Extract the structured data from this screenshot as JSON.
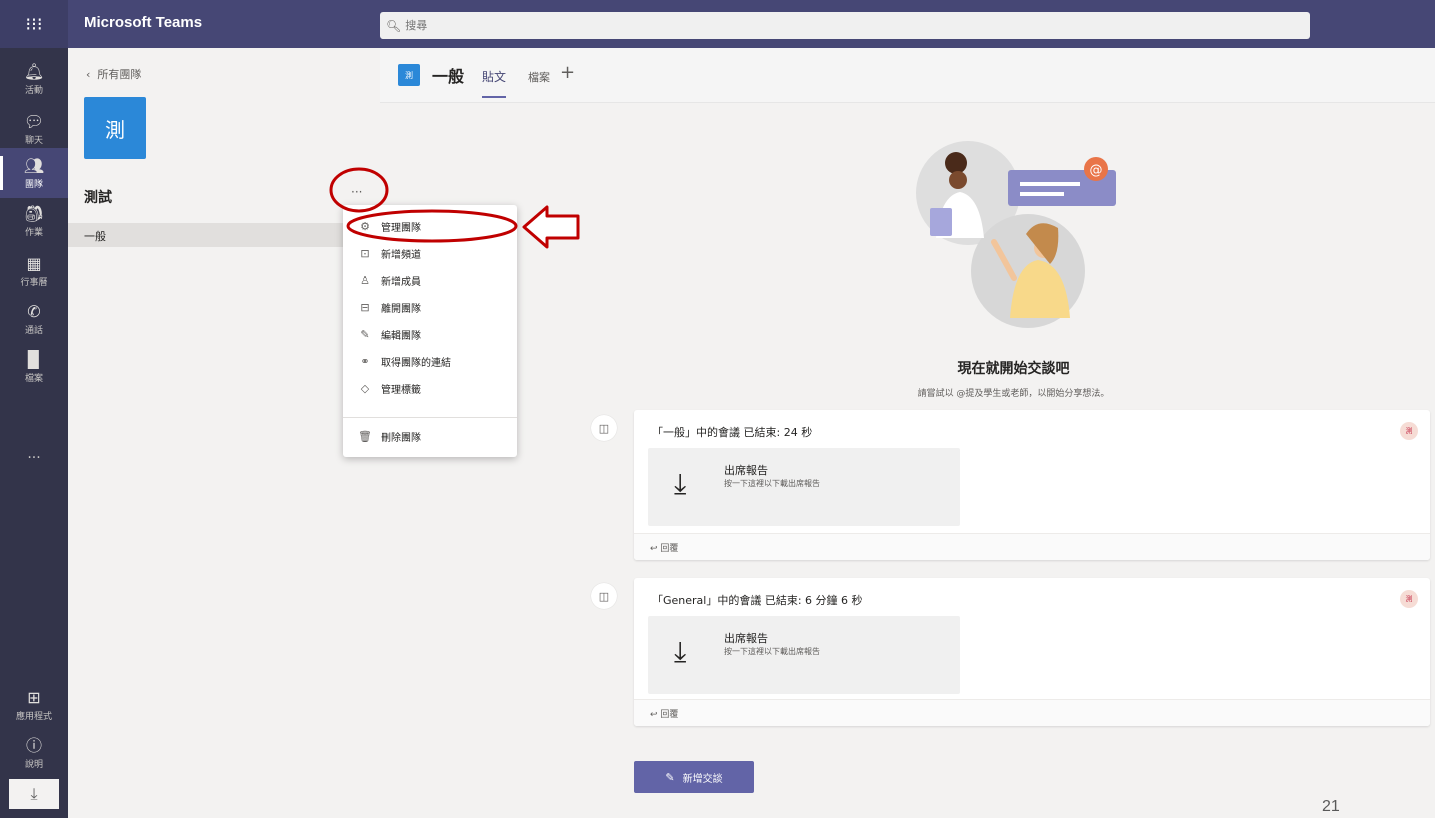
{
  "topbar": {
    "app_title": "Microsoft Teams",
    "search_icon": "search-icon",
    "search_placeholder": "搜尋"
  },
  "rail": {
    "items": [
      {
        "label": "活動",
        "icon": "bell-icon"
      },
      {
        "label": "聊天",
        "icon": "chat-icon"
      },
      {
        "label": "團隊",
        "icon": "teams-icon"
      },
      {
        "label": "作業",
        "icon": "assignments-icon"
      },
      {
        "label": "行事曆",
        "icon": "calendar-icon"
      },
      {
        "label": "通話",
        "icon": "phone-icon"
      },
      {
        "label": "檔案",
        "icon": "file-icon"
      }
    ],
    "more": "···",
    "apps_label": "應用程式",
    "help_label": "說明"
  },
  "team_panel": {
    "back_label": "所有團隊",
    "team_avatar_text": "測",
    "team_name": "測試",
    "more_label": "···",
    "channels": [
      {
        "label": "一般"
      }
    ]
  },
  "context_menu": {
    "items": [
      {
        "label": "管理團隊",
        "icon": "gear-icon"
      },
      {
        "label": "新增頻道",
        "icon": "add-channel-icon"
      },
      {
        "label": "新增成員",
        "icon": "add-member-icon"
      },
      {
        "label": "離開團隊",
        "icon": "leave-team-icon"
      },
      {
        "label": "編輯團隊",
        "icon": "pencil-icon"
      },
      {
        "label": "取得團隊的連結",
        "icon": "link-icon"
      },
      {
        "label": "管理標籤",
        "icon": "tag-icon"
      },
      {
        "label": "刪除團隊",
        "icon": "trash-icon"
      }
    ]
  },
  "channel_header": {
    "avatar_text": "測",
    "channel_name": "一般",
    "tabs": [
      {
        "label": "貼文",
        "active": true
      },
      {
        "label": "檔案",
        "active": false
      }
    ],
    "add_tab": "+"
  },
  "welcome": {
    "title": "現在就開始交談吧",
    "subtitle": "請嘗試以 @提及學生或老師，以開始分享想法。"
  },
  "posts": [
    {
      "title": "「一般」中的會議 已結束: 24 秒",
      "avatar_text": "測",
      "report_title": "出席報告",
      "report_desc": "按一下這裡以下載出席報告",
      "reply_label": "回覆"
    },
    {
      "title": "「General」中的會議 已結束: 6 分鐘 6 秒",
      "avatar_text": "測",
      "report_title": "出席報告",
      "report_desc": "按一下這裡以下載出席報告",
      "reply_label": "回覆"
    }
  ],
  "new_conversation_label": "新增交談",
  "page_number": "21",
  "colors": {
    "topbar": "#464775",
    "rail": "#33344a",
    "accent": "#6264a7",
    "team_blue": "#2b88d8",
    "annotation_red": "#c00000"
  }
}
